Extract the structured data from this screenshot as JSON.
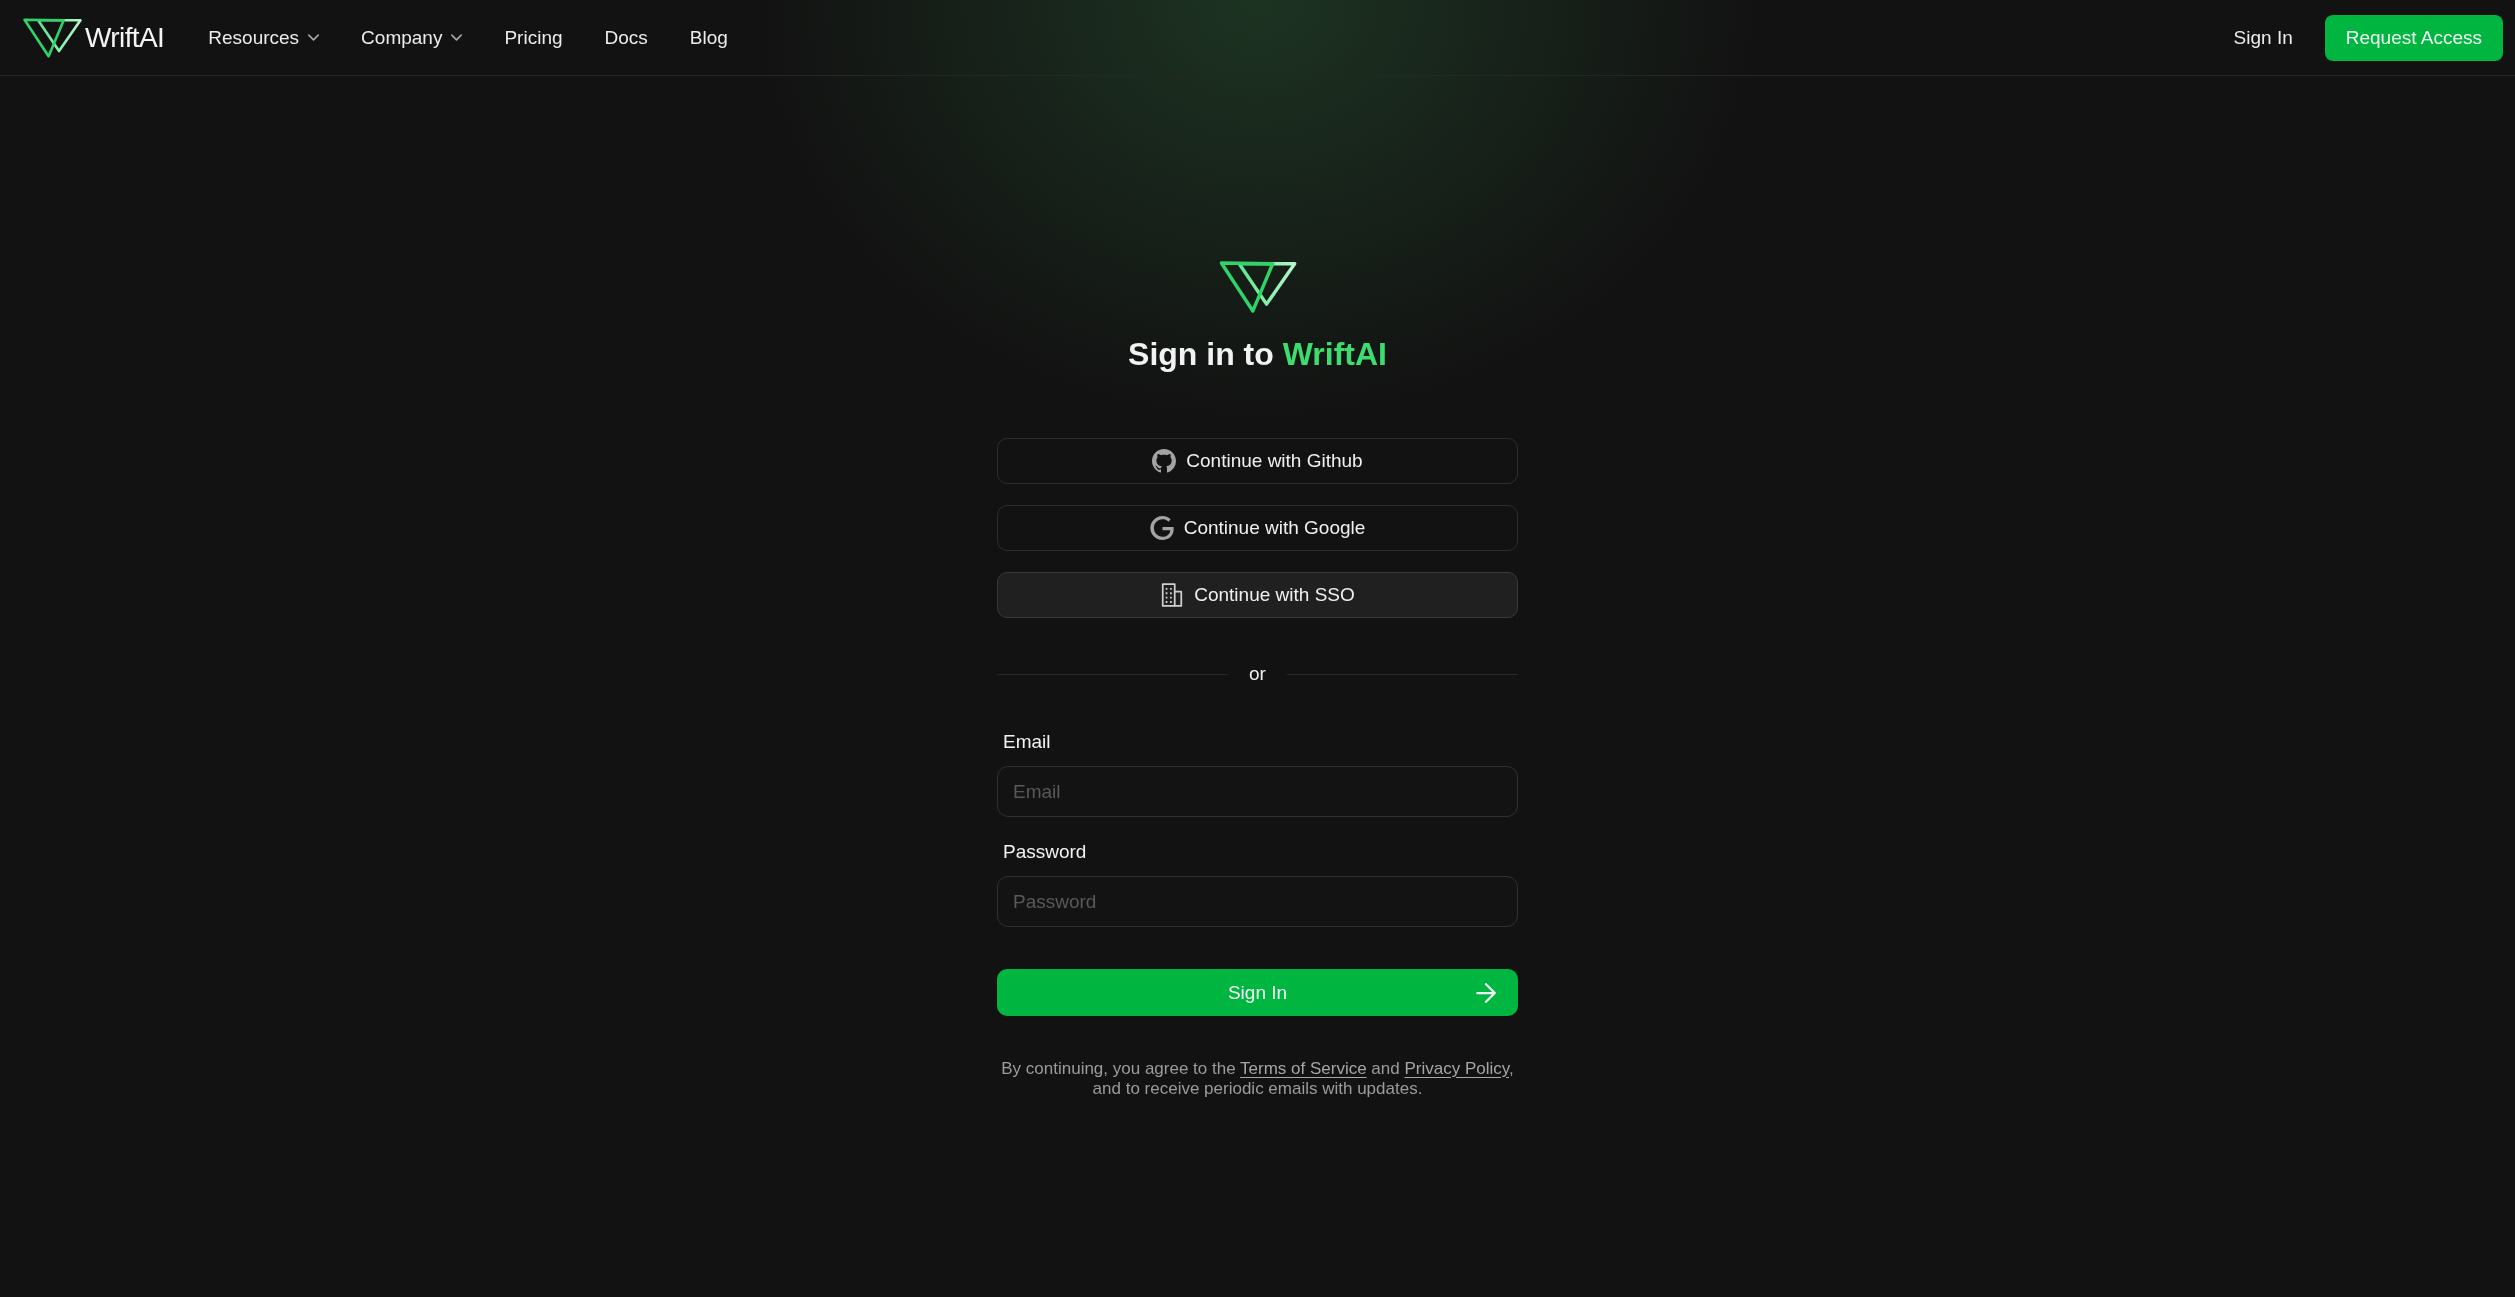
{
  "nav": {
    "brand": "WriftAI",
    "links": [
      {
        "label": "Resources",
        "dropdown": true
      },
      {
        "label": "Company",
        "dropdown": true
      },
      {
        "label": "Pricing",
        "dropdown": false
      },
      {
        "label": "Docs",
        "dropdown": false
      },
      {
        "label": "Blog",
        "dropdown": false
      }
    ],
    "sign_in": "Sign In",
    "cta": "Request Access"
  },
  "auth": {
    "title": {
      "text": "Sign in to",
      "brand": "WriftAI"
    },
    "providers": [
      {
        "kind": "github",
        "label": "Continue with Github",
        "hovered": false
      },
      {
        "kind": "google",
        "label": "Continue with Google",
        "hovered": false
      },
      {
        "kind": "sso",
        "label": "Continue with SSO",
        "hovered": true
      }
    ],
    "divider": "or",
    "fields": [
      {
        "label": "Email",
        "placeholder": "Email"
      },
      {
        "label": "Password",
        "placeholder": "Password"
      }
    ],
    "submit": "Sign In",
    "terms": {
      "lines": [
        [
          {
            "kind": "text",
            "text": "By continuing, you agree to the "
          },
          {
            "kind": "link",
            "text": "Terms of Service"
          },
          {
            "kind": "text",
            "text": " and "
          },
          {
            "kind": "link",
            "text": "Privacy Policy"
          },
          {
            "kind": "text",
            "text": ","
          }
        ],
        [
          {
            "kind": "text",
            "text": "and to receive periodic emails with updates."
          }
        ]
      ]
    }
  }
}
